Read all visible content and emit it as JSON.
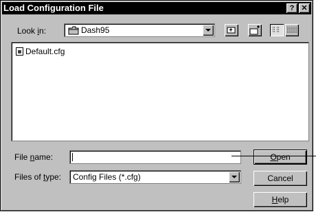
{
  "window": {
    "title": "Load Configuration File",
    "help_glyph": "?",
    "close_glyph": "✕"
  },
  "look_in": {
    "label_prefix": "Look ",
    "label_underlined": "i",
    "label_suffix": "n:",
    "value": "Dash95",
    "icon": "folder-icon"
  },
  "toolbar": {
    "icons": [
      "up-folder-icon",
      "new-folder-icon",
      "list-view-icon",
      "details-view-icon"
    ]
  },
  "files": [
    {
      "name": "Default.cfg",
      "icon": "config-file-icon"
    }
  ],
  "file_name": {
    "label_prefix": "File ",
    "label_underlined": "n",
    "label_suffix": "ame:",
    "value": ""
  },
  "files_of_type": {
    "label_prefix": "Files of ",
    "label_underlined": "t",
    "label_suffix": "ype:",
    "value": "Config Files (*.cfg)"
  },
  "buttons": {
    "open": {
      "underlined": "O",
      "rest": "pen"
    },
    "cancel": {
      "label": "Cancel"
    },
    "help": {
      "underlined": "H",
      "rest": "elp"
    }
  }
}
